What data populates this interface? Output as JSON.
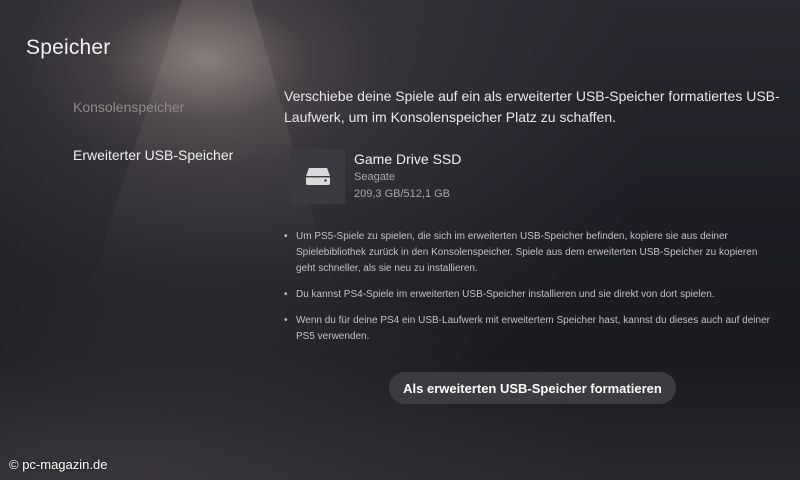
{
  "header": {
    "title": "Speicher"
  },
  "sidebar": {
    "items": [
      {
        "label": "Konsolenspeicher"
      },
      {
        "label": "Erweiterter USB-Speicher"
      }
    ]
  },
  "main": {
    "description": "Verschiebe deine Spiele auf ein als erweiterter USB-Speicher formatiertes USB-Laufwerk, um im Konsolenspeicher Platz zu schaffen.",
    "drive": {
      "icon": "external-drive-icon",
      "name": "Game Drive SSD",
      "manufacturer": "Seagate",
      "capacity": "209,3 GB/512,1 GB"
    },
    "notes": [
      "Um PS5-Spiele zu spielen, die sich im erweiterten USB-Speicher befinden, kopiere sie aus deiner Spielebibliothek zurück in den Konsolenspeicher. Spiele aus dem erweiterten USB-Speicher zu kopieren geht schneller, als sie neu zu installieren.",
      "Du kannst PS4-Spiele im erweiterten USB-Speicher installieren und sie direkt von dort spielen.",
      "Wenn du für deine PS4 ein USB-Laufwerk mit erweitertem Speicher hast, kannst du dieses auch auf deiner PS5 verwenden."
    ],
    "bullet": "•",
    "format_button_label": "Als erweiterten USB-Speicher formatieren"
  },
  "watermark": "© pc-magazin.de"
}
